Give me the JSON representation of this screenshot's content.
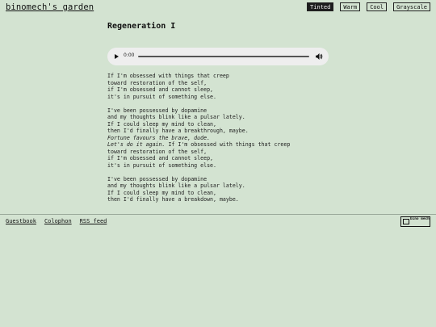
{
  "header": {
    "site_title": "binomech's garden",
    "themes": [
      {
        "label": "Tinted",
        "active": true
      },
      {
        "label": "Warm",
        "active": false
      },
      {
        "label": "Cool",
        "active": false
      },
      {
        "label": "Grayscale",
        "active": false
      }
    ]
  },
  "song": {
    "title": "Regeneration I"
  },
  "player": {
    "time": "0:00",
    "progress": 0
  },
  "lyrics": {
    "stanza1": [
      "If I'm obsessed with things that creep",
      "toward restoration of the self,",
      "if I'm obsessed and cannot sleep,",
      "it's in pursuit of something else."
    ],
    "stanza2": [
      "I've been possessed by dopamine",
      "and my thoughts blink like a pulsar lately.",
      "If I could sleep my mind to clean,",
      "then I'd finally have a breakthrough, maybe."
    ],
    "stanza2_italic1": "Fortune favours the brave, dude.",
    "stanza2_italic2": "Let's do it again.",
    "stanza2_after_italic": " If I'm obsessed with things that creep",
    "stanza2b": [
      "toward restoration of the self,",
      "if I'm obsessed and cannot sleep,",
      "it's in pursuit of something else."
    ],
    "stanza3": [
      "I've been possessed by dopamine",
      "and my thoughts blink like a pulsar lately.",
      "If I could sleep my mind to clean,",
      "then I'd finally have a breakdown, maybe."
    ]
  },
  "footer": {
    "links": [
      "Guestbook",
      "Colophon",
      "RSS feed"
    ],
    "badge_text": "bino mech"
  },
  "colors": {
    "background": "#d3e3d1",
    "text": "#1b1b1b",
    "active_button": "#1d1d1d",
    "player": "#eeeeee"
  },
  "icons": {
    "play": "play-icon",
    "volume": "volume-icon",
    "badge": "cube-icon"
  }
}
